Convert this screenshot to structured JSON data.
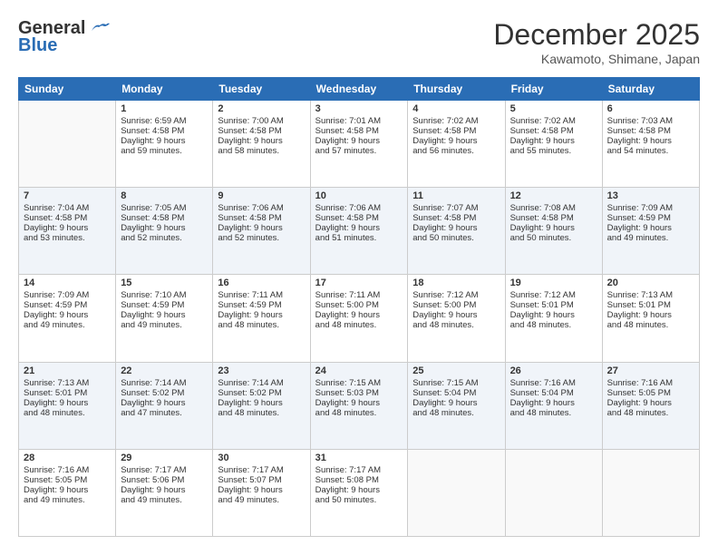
{
  "header": {
    "logo_general": "General",
    "logo_blue": "Blue",
    "month_title": "December 2025",
    "location": "Kawamoto, Shimane, Japan"
  },
  "days_of_week": [
    "Sunday",
    "Monday",
    "Tuesday",
    "Wednesday",
    "Thursday",
    "Friday",
    "Saturday"
  ],
  "weeks": [
    [
      {
        "day": "",
        "content": ""
      },
      {
        "day": "1",
        "content": "Sunrise: 6:59 AM\nSunset: 4:58 PM\nDaylight: 9 hours\nand 59 minutes."
      },
      {
        "day": "2",
        "content": "Sunrise: 7:00 AM\nSunset: 4:58 PM\nDaylight: 9 hours\nand 58 minutes."
      },
      {
        "day": "3",
        "content": "Sunrise: 7:01 AM\nSunset: 4:58 PM\nDaylight: 9 hours\nand 57 minutes."
      },
      {
        "day": "4",
        "content": "Sunrise: 7:02 AM\nSunset: 4:58 PM\nDaylight: 9 hours\nand 56 minutes."
      },
      {
        "day": "5",
        "content": "Sunrise: 7:02 AM\nSunset: 4:58 PM\nDaylight: 9 hours\nand 55 minutes."
      },
      {
        "day": "6",
        "content": "Sunrise: 7:03 AM\nSunset: 4:58 PM\nDaylight: 9 hours\nand 54 minutes."
      }
    ],
    [
      {
        "day": "7",
        "content": "Sunrise: 7:04 AM\nSunset: 4:58 PM\nDaylight: 9 hours\nand 53 minutes."
      },
      {
        "day": "8",
        "content": "Sunrise: 7:05 AM\nSunset: 4:58 PM\nDaylight: 9 hours\nand 52 minutes."
      },
      {
        "day": "9",
        "content": "Sunrise: 7:06 AM\nSunset: 4:58 PM\nDaylight: 9 hours\nand 52 minutes."
      },
      {
        "day": "10",
        "content": "Sunrise: 7:06 AM\nSunset: 4:58 PM\nDaylight: 9 hours\nand 51 minutes."
      },
      {
        "day": "11",
        "content": "Sunrise: 7:07 AM\nSunset: 4:58 PM\nDaylight: 9 hours\nand 50 minutes."
      },
      {
        "day": "12",
        "content": "Sunrise: 7:08 AM\nSunset: 4:58 PM\nDaylight: 9 hours\nand 50 minutes."
      },
      {
        "day": "13",
        "content": "Sunrise: 7:09 AM\nSunset: 4:59 PM\nDaylight: 9 hours\nand 49 minutes."
      }
    ],
    [
      {
        "day": "14",
        "content": "Sunrise: 7:09 AM\nSunset: 4:59 PM\nDaylight: 9 hours\nand 49 minutes."
      },
      {
        "day": "15",
        "content": "Sunrise: 7:10 AM\nSunset: 4:59 PM\nDaylight: 9 hours\nand 49 minutes."
      },
      {
        "day": "16",
        "content": "Sunrise: 7:11 AM\nSunset: 4:59 PM\nDaylight: 9 hours\nand 48 minutes."
      },
      {
        "day": "17",
        "content": "Sunrise: 7:11 AM\nSunset: 5:00 PM\nDaylight: 9 hours\nand 48 minutes."
      },
      {
        "day": "18",
        "content": "Sunrise: 7:12 AM\nSunset: 5:00 PM\nDaylight: 9 hours\nand 48 minutes."
      },
      {
        "day": "19",
        "content": "Sunrise: 7:12 AM\nSunset: 5:01 PM\nDaylight: 9 hours\nand 48 minutes."
      },
      {
        "day": "20",
        "content": "Sunrise: 7:13 AM\nSunset: 5:01 PM\nDaylight: 9 hours\nand 48 minutes."
      }
    ],
    [
      {
        "day": "21",
        "content": "Sunrise: 7:13 AM\nSunset: 5:01 PM\nDaylight: 9 hours\nand 48 minutes."
      },
      {
        "day": "22",
        "content": "Sunrise: 7:14 AM\nSunset: 5:02 PM\nDaylight: 9 hours\nand 47 minutes."
      },
      {
        "day": "23",
        "content": "Sunrise: 7:14 AM\nSunset: 5:02 PM\nDaylight: 9 hours\nand 48 minutes."
      },
      {
        "day": "24",
        "content": "Sunrise: 7:15 AM\nSunset: 5:03 PM\nDaylight: 9 hours\nand 48 minutes."
      },
      {
        "day": "25",
        "content": "Sunrise: 7:15 AM\nSunset: 5:04 PM\nDaylight: 9 hours\nand 48 minutes."
      },
      {
        "day": "26",
        "content": "Sunrise: 7:16 AM\nSunset: 5:04 PM\nDaylight: 9 hours\nand 48 minutes."
      },
      {
        "day": "27",
        "content": "Sunrise: 7:16 AM\nSunset: 5:05 PM\nDaylight: 9 hours\nand 48 minutes."
      }
    ],
    [
      {
        "day": "28",
        "content": "Sunrise: 7:16 AM\nSunset: 5:05 PM\nDaylight: 9 hours\nand 49 minutes."
      },
      {
        "day": "29",
        "content": "Sunrise: 7:17 AM\nSunset: 5:06 PM\nDaylight: 9 hours\nand 49 minutes."
      },
      {
        "day": "30",
        "content": "Sunrise: 7:17 AM\nSunset: 5:07 PM\nDaylight: 9 hours\nand 49 minutes."
      },
      {
        "day": "31",
        "content": "Sunrise: 7:17 AM\nSunset: 5:08 PM\nDaylight: 9 hours\nand 50 minutes."
      },
      {
        "day": "",
        "content": ""
      },
      {
        "day": "",
        "content": ""
      },
      {
        "day": "",
        "content": ""
      }
    ]
  ]
}
